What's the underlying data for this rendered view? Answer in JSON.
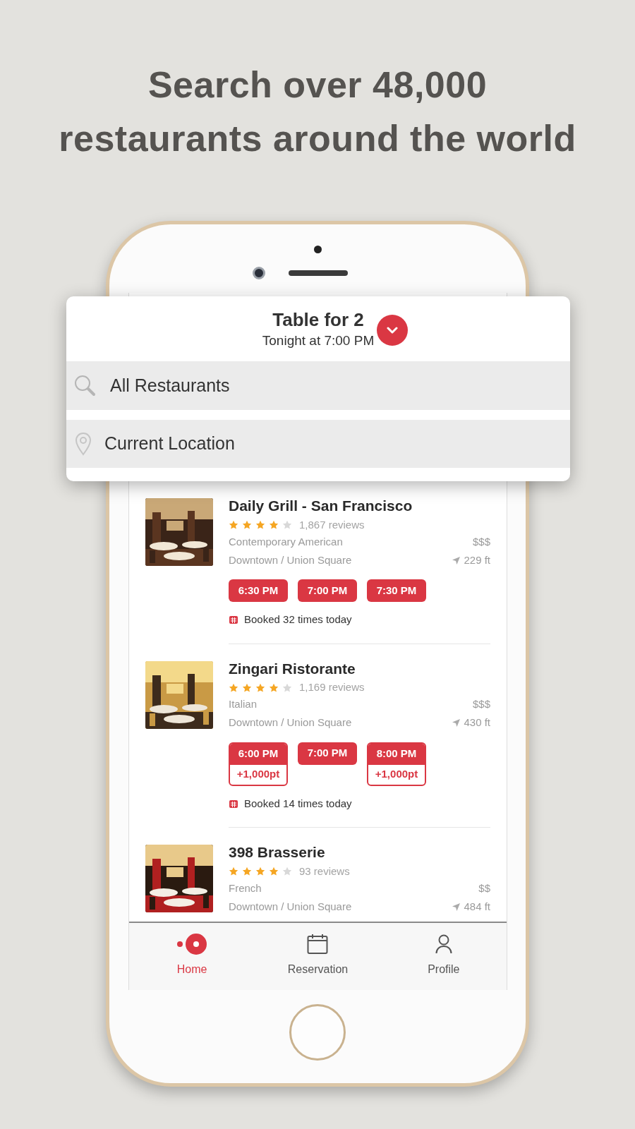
{
  "headline_lines": [
    "Search over 48,000",
    "restaurants around the world"
  ],
  "search_card": {
    "title": "Table for 2",
    "subtitle": "Tonight at 7:00 PM",
    "search_field": {
      "value": "All Restaurants"
    },
    "location_field": {
      "value": "Current Location"
    }
  },
  "listings": [
    {
      "name": "Daily Grill - San Francisco",
      "stars": 4,
      "reviews": "1,867 reviews",
      "cuisine": "Contemporary American",
      "price": "$$$",
      "area": "Downtown / Union Square",
      "distance": "229 ft",
      "slots": [
        {
          "time": "6:30 PM"
        },
        {
          "time": "7:00 PM"
        },
        {
          "time": "7:30 PM"
        }
      ],
      "booked": "Booked 32 times today"
    },
    {
      "name": "Zingari Ristorante",
      "stars": 4,
      "reviews": "1,169 reviews",
      "cuisine": "Italian",
      "price": "$$$",
      "area": "Downtown / Union Square",
      "distance": "430 ft",
      "slots": [
        {
          "time": "6:00 PM",
          "points": "+1,000pt"
        },
        {
          "time": "7:00 PM"
        },
        {
          "time": "8:00 PM",
          "points": "+1,000pt"
        }
      ],
      "booked": "Booked 14 times today"
    },
    {
      "name": "398 Brasserie",
      "stars": 4,
      "reviews": "93 reviews",
      "cuisine": "French",
      "price": "$$",
      "area": "Downtown / Union Square",
      "distance": "484 ft"
    }
  ],
  "tab_bar": [
    {
      "label": "Home",
      "kind": "home",
      "selected": true
    },
    {
      "label": "Reservation",
      "kind": "calendar",
      "selected": false
    },
    {
      "label": "Profile",
      "kind": "profile",
      "selected": false
    }
  ]
}
